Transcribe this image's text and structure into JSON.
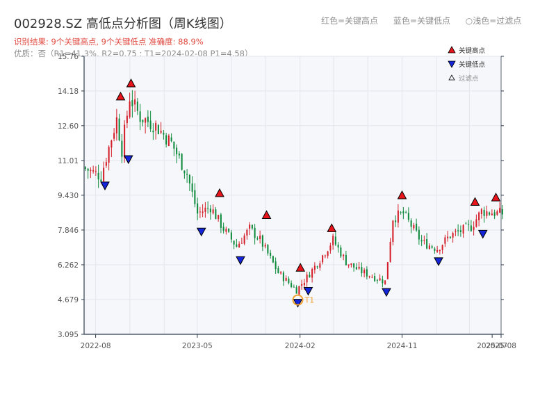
{
  "header": {
    "title": "002928.SZ 高低点分析图（周K线图）",
    "result_line": "识别结果: 9个关键高点, 9个关键低点   准确度: 88.9%",
    "quality_line": "优质：否（R1=41.3%, R2=0.75 ; T1=2024-02-08 P1=4.58）"
  },
  "top_legend": [
    "红色=关键高点",
    "蓝色=关键低点",
    "○浅色=过滤点"
  ],
  "colors": {
    "up": "#d41f2a",
    "down": "#0e8a3c",
    "high_marker": "#e8141c",
    "low_marker": "#1424d8",
    "t1_ring": "#f0a030",
    "plot_bg": "#f5f7fa",
    "grid": "#e3e6ec",
    "axis": "#2f3b4c"
  },
  "chart_data": {
    "type": "candlestick",
    "title": "002928.SZ 高低点分析图（周K线图）",
    "x_range": [
      "2022-07-01",
      "2025-07-25"
    ],
    "ylim": [
      3.095,
      15.76
    ],
    "y_ticks": [
      "3.095",
      "4.679",
      "6.262",
      "7.846",
      "9.430",
      "11.01",
      "12.60",
      "14.18",
      "15.76"
    ],
    "y_tick_values": [
      3.095,
      4.679,
      6.262,
      7.846,
      9.43,
      11.01,
      12.6,
      14.18,
      15.76
    ],
    "x_ticks": [
      {
        "label": "2022-08",
        "date": "2022-08-01"
      },
      {
        "label": "2023-05",
        "date": "2023-05-01"
      },
      {
        "label": "2024-02",
        "date": "2024-02-01"
      },
      {
        "label": "2024-11",
        "date": "2024-11-01"
      },
      {
        "label": "2025-07",
        "date": "2025-07-01"
      },
      {
        "label": "2025-08",
        "date": "2025-07-25"
      }
    ],
    "price_keypoints": [
      {
        "date": "2022-07-01",
        "close": 10.7
      },
      {
        "date": "2022-08-19",
        "close": 10.3
      },
      {
        "date": "2022-09-30",
        "close": 12.9
      },
      {
        "date": "2022-10-14",
        "close": 11.5
      },
      {
        "date": "2022-11-04",
        "close": 13.9
      },
      {
        "date": "2022-12-02",
        "close": 13.0
      },
      {
        "date": "2023-01-13",
        "close": 12.6
      },
      {
        "date": "2023-02-24",
        "close": 11.8
      },
      {
        "date": "2023-04-07",
        "close": 10.4
      },
      {
        "date": "2023-05-05",
        "close": 8.6
      },
      {
        "date": "2023-06-09",
        "close": 8.9
      },
      {
        "date": "2023-07-14",
        "close": 7.9
      },
      {
        "date": "2023-08-18",
        "close": 7.1
      },
      {
        "date": "2023-09-22",
        "close": 7.9
      },
      {
        "date": "2023-10-20",
        "close": 7.4
      },
      {
        "date": "2023-12-08",
        "close": 5.9
      },
      {
        "date": "2024-01-26",
        "close": 5.1
      },
      {
        "date": "2024-02-23",
        "close": 5.7
      },
      {
        "date": "2024-03-29",
        "close": 6.5
      },
      {
        "date": "2024-05-03",
        "close": 7.4
      },
      {
        "date": "2024-06-07",
        "close": 6.4
      },
      {
        "date": "2024-07-12",
        "close": 6.0
      },
      {
        "date": "2024-09-20",
        "close": 5.5
      },
      {
        "date": "2024-10-11",
        "close": 8.4
      },
      {
        "date": "2024-11-08",
        "close": 8.6
      },
      {
        "date": "2024-12-27",
        "close": 7.3
      },
      {
        "date": "2025-02-07",
        "close": 7.0
      },
      {
        "date": "2025-03-14",
        "close": 7.6
      },
      {
        "date": "2025-05-09",
        "close": 8.0
      },
      {
        "date": "2025-06-06",
        "close": 8.7
      },
      {
        "date": "2025-07-25",
        "close": 8.6
      }
    ],
    "key_highs": [
      {
        "date": "2022-10-07",
        "price": 13.8
      },
      {
        "date": "2022-11-04",
        "price": 14.4
      },
      {
        "date": "2023-06-30",
        "price": 9.4
      },
      {
        "date": "2023-11-03",
        "price": 8.4
      },
      {
        "date": "2024-02-02",
        "price": 6.0
      },
      {
        "date": "2024-04-26",
        "price": 7.8
      },
      {
        "date": "2024-11-01",
        "price": 9.3
      },
      {
        "date": "2025-05-16",
        "price": 9.0
      },
      {
        "date": "2025-07-11",
        "price": 9.2
      }
    ],
    "key_lows": [
      {
        "date": "2022-08-26",
        "price": 10.0
      },
      {
        "date": "2022-10-28",
        "price": 11.2
      },
      {
        "date": "2023-05-12",
        "price": 7.9
      },
      {
        "date": "2023-08-25",
        "price": 6.6
      },
      {
        "date": "2024-01-26",
        "price": 4.66
      },
      {
        "date": "2024-02-23",
        "price": 5.2
      },
      {
        "date": "2024-09-20",
        "price": 5.15
      },
      {
        "date": "2025-02-07",
        "price": 6.55
      },
      {
        "date": "2025-06-06",
        "price": 7.8
      }
    ],
    "t1": {
      "label": "T1",
      "date": "2024-01-26",
      "price": 4.66
    },
    "legend": [
      {
        "label": "关键高点",
        "marker": "triangle-up",
        "color": "#e8141c"
      },
      {
        "label": "关键低点",
        "marker": "triangle-down",
        "color": "#1424d8"
      },
      {
        "label": "过滤点",
        "marker": "triangle-up-outline",
        "color": "#8c8c8c"
      }
    ],
    "legend_position": "top-right",
    "grid": true
  }
}
